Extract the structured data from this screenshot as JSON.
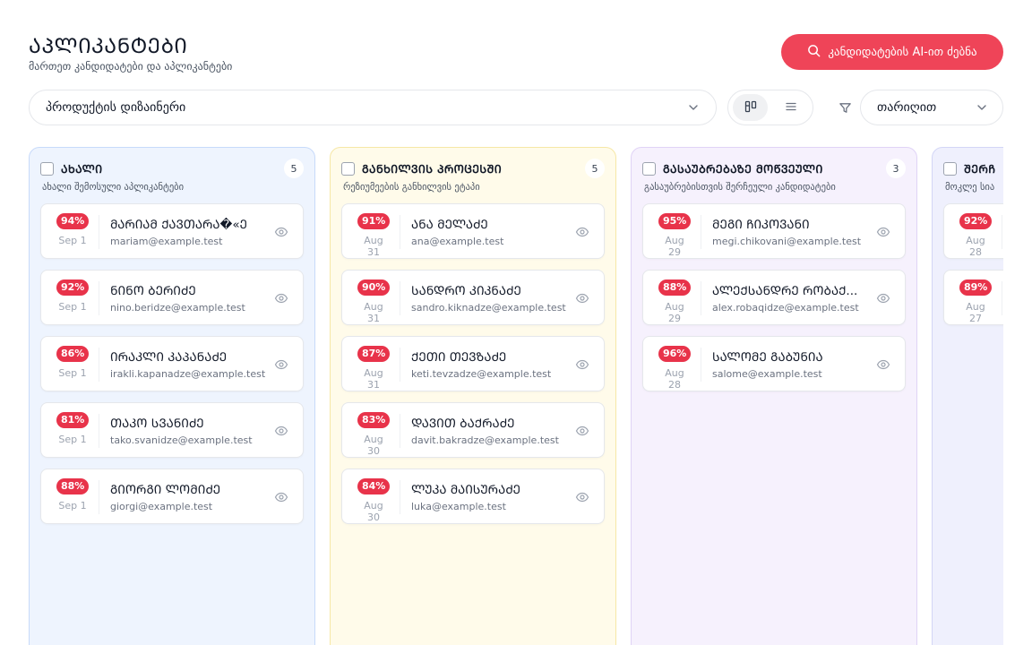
{
  "header": {
    "title": "ᲐᲞᲚᲘᲙᲐᲜᲢᲔᲑᲘ",
    "subtitle": "მართეთ კანდიდატები და აპლიკანტები",
    "ai_search_label": "კანდიდატების AI-ით ძებნა"
  },
  "toolbar": {
    "position_value": "პროდუქტის დიზაინერი",
    "sort_value": "თარიღით",
    "view_mode": "board"
  },
  "icons": {
    "search": "search-icon",
    "chevron": "chevron-down-icon",
    "board_view": "kanban-icon",
    "list_view": "list-icon",
    "filter": "filter-icon",
    "view": "eye-icon"
  },
  "colors": {
    "accent": "#ef4458",
    "score_badge": "#e8334a"
  },
  "columns": [
    {
      "title": "ᲐᲮᲐᲚᲘ",
      "count": "5",
      "description": "ახალი შემოსული აპლიკანტები",
      "bg": "#eef4fe",
      "border": "#c7dafa",
      "cards": [
        {
          "score": "94%",
          "date": "Sep 1",
          "name": "ᲛᲐᲠᲘᲐᲛ ᲥᲐᲕᲗᲐᲠᲐ�«Ე",
          "email": "mariam@example.test"
        },
        {
          "score": "92%",
          "date": "Sep 1",
          "name": "ᲜᲘᲜᲝ ᲑᲔᲠᲘᲫᲔ",
          "email": "nino.beridze@example.test"
        },
        {
          "score": "86%",
          "date": "Sep 1",
          "name": "ᲘᲠᲐᲙᲚᲘ ᲙᲐᲞᲐᲜᲐᲫᲔ",
          "email": "irakli.kapanadze@example.test"
        },
        {
          "score": "81%",
          "date": "Sep 1",
          "name": "ᲗᲐᲙᲝ ᲡᲕᲐᲜᲘᲫᲔ",
          "email": "tako.svanidze@example.test"
        },
        {
          "score": "88%",
          "date": "Sep 1",
          "name": "ᲒᲘᲝᲠᲒᲘ ᲚᲝᲛᲘᲫᲔ",
          "email": "giorgi@example.test"
        }
      ]
    },
    {
      "title": "ᲒᲐᲜᲮᲘᲚᲕᲘᲡ ᲞᲠᲝᲪᲔᲡᲨᲘ",
      "count": "5",
      "description": "რეზიუმეების განხილვის ეტაპი",
      "bg": "#fffbea",
      "border": "#f6e7a6",
      "cards": [
        {
          "score": "91%",
          "date": "Aug 31",
          "name": "ᲐᲜᲐ ᲛᲔᲚᲐᲫᲔ",
          "email": "ana@example.test"
        },
        {
          "score": "90%",
          "date": "Aug 31",
          "name": "ᲡᲐᲜᲓᲠᲝ ᲙᲘᲙᲜᲐᲫᲔ",
          "email": "sandro.kiknadze@example.test"
        },
        {
          "score": "87%",
          "date": "Aug 31",
          "name": "ᲥᲔᲗᲘ ᲗᲔᲕᲖᲐᲫᲔ",
          "email": "keti.tevzadze@example.test"
        },
        {
          "score": "83%",
          "date": "Aug 30",
          "name": "ᲓᲐᲕᲘᲗ ᲑᲐᲥᲠᲐᲫᲔ",
          "email": "davit.bakradze@example.test"
        },
        {
          "score": "84%",
          "date": "Aug 30",
          "name": "ᲚᲣᲙᲐ ᲛᲐᲘᲡᲣᲠᲐᲫᲔ",
          "email": "luka@example.test"
        }
      ]
    },
    {
      "title": "ᲒᲐᲡᲐᲣᲑᲠᲔᲑᲐᲖᲔ ᲛᲝᲬᲕᲔᲣᲚᲘ",
      "count": "3",
      "description": "გასაუბრებისთვის შერჩეული კანდიდატები",
      "bg": "#f6f1fd",
      "border": "#e0d3f6",
      "cards": [
        {
          "score": "95%",
          "date": "Aug 29",
          "name": "ᲛᲔᲒᲘ ᲩᲘᲙᲝᲕᲐᲜᲘ",
          "email": "megi.chikovani@example.test"
        },
        {
          "score": "88%",
          "date": "Aug 29",
          "name": "ᲐᲚᲔᲥᲡᲐᲜᲓᲠᲔ ᲠᲝᲑᲐᲥ...",
          "email": "alex.robaqidze@example.test"
        },
        {
          "score": "96%",
          "date": "Aug 28",
          "name": "ᲡᲐᲚᲝᲛᲔ ᲒᲐᲑᲣᲜᲘᲐ",
          "email": "salome@example.test"
        }
      ]
    },
    {
      "title": "ᲨᲔᲠᲩ",
      "count": "",
      "description": "მოკლე სია",
      "bg": "#eff0fd",
      "border": "#d3d6f6",
      "cards": [
        {
          "score": "92%",
          "date": "Aug 28",
          "name": "",
          "email": ""
        },
        {
          "score": "89%",
          "date": "Aug 27",
          "name": "",
          "email": ""
        }
      ]
    }
  ]
}
